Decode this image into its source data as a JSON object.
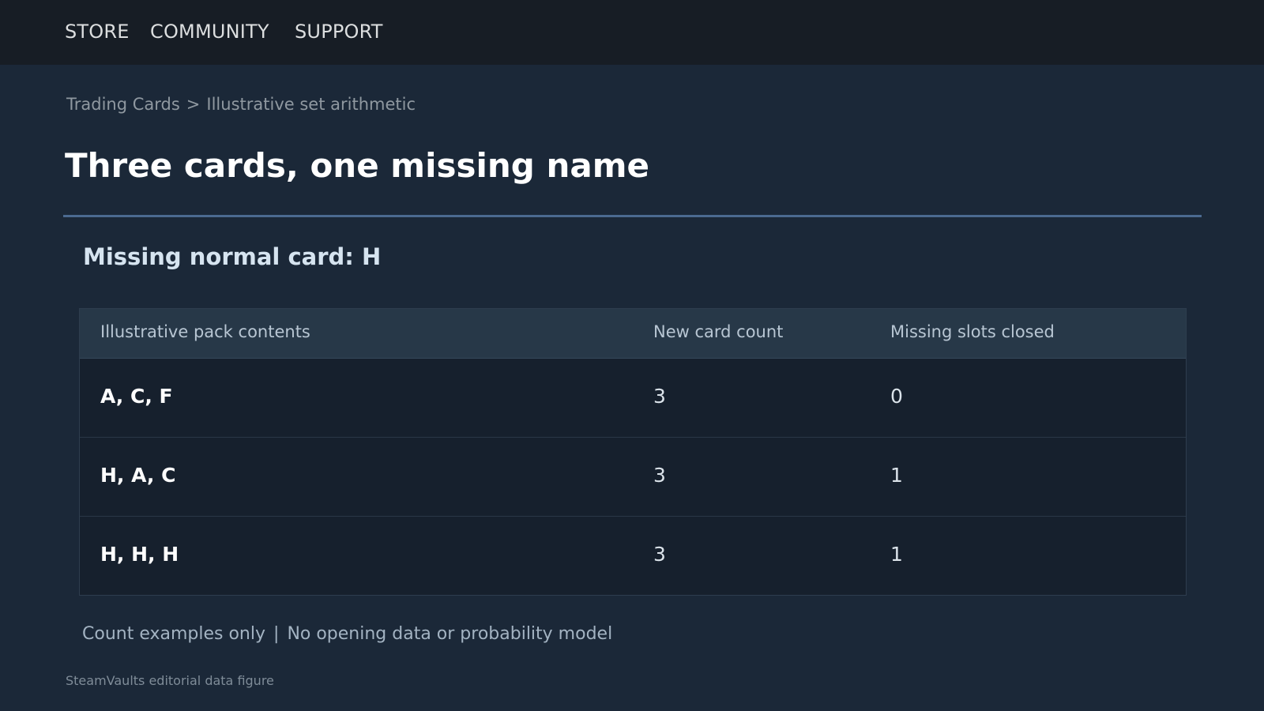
{
  "nav": {
    "items": [
      {
        "label": "STORE"
      },
      {
        "label": "COMMUNITY"
      },
      {
        "label": "SUPPORT"
      }
    ]
  },
  "breadcrumb": {
    "parent": "Trading Cards",
    "separator": ">",
    "current": "Illustrative set arithmetic"
  },
  "page": {
    "title": "Three cards, one missing name",
    "subheading": "Missing normal card: H"
  },
  "table": {
    "headers": [
      "Illustrative pack contents",
      "New card count",
      "Missing slots closed"
    ],
    "rows": [
      {
        "contents": "A, C, F",
        "new_count": "3",
        "closed": "0"
      },
      {
        "contents": "H, A, C",
        "new_count": "3",
        "closed": "1"
      },
      {
        "contents": "H, H, H",
        "new_count": "3",
        "closed": "1"
      }
    ]
  },
  "footnote": {
    "left": "Count examples only",
    "separator": "|",
    "right": "No opening data or probability model"
  },
  "credit": "SteamVaults editorial data figure",
  "colors": {
    "background": "#1b2838",
    "nav_background": "#171d25",
    "rule": "#4b6a90",
    "table_header": "#273848",
    "table_row": "#16202d"
  }
}
